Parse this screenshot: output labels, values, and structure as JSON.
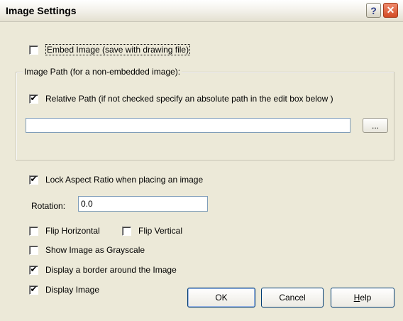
{
  "window": {
    "title": "Image Settings",
    "help_glyph": "?",
    "close_glyph": "✕"
  },
  "embed": {
    "label": "Embed Image (save with drawing file)",
    "checked": false
  },
  "image_path": {
    "group_label": "Image Path (for a non-embedded image):",
    "relative_label": "Relative Path (if not checked specify an absolute path in the edit box below )",
    "relative_checked": true,
    "path_value": "",
    "browse_label": "..."
  },
  "lock_aspect": {
    "label": "Lock Aspect Ratio when placing an image",
    "checked": true
  },
  "rotation": {
    "label": "Rotation:",
    "value": "0.0"
  },
  "flip_horizontal": {
    "label": "Flip Horizontal",
    "checked": false
  },
  "flip_vertical": {
    "label": "Flip Vertical",
    "checked": false
  },
  "grayscale": {
    "label": "Show Image as Grayscale",
    "checked": false
  },
  "border": {
    "label": "Display a border around the Image",
    "checked": true
  },
  "display_image": {
    "label": "Display Image",
    "checked": true
  },
  "buttons": {
    "ok": "OK",
    "cancel": "Cancel",
    "help_first": "H",
    "help_rest": "elp"
  },
  "check_glyph": "✔",
  "colors": {
    "dialog_bg": "#ece9d8",
    "button_border": "#003c74",
    "close_red": "#d24a25"
  }
}
